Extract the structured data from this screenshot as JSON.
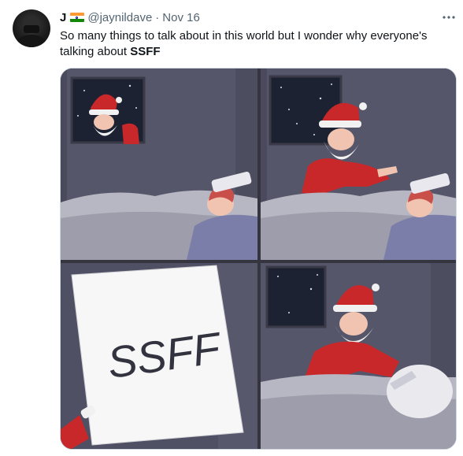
{
  "tweet": {
    "author_name": "J",
    "flag_icon": "india-flag-icon",
    "handle": "@jaynildave",
    "separator": "·",
    "date": "Nov 16",
    "more_icon": "more-options-icon",
    "text_before": "So many things to talk about in this world but I wonder why everyone's talking about ",
    "text_bold": "SSFF"
  },
  "comic": {
    "paper_text": "SSFF",
    "colors": {
      "wall": "#56566a",
      "night": "#1d2233",
      "santa_red": "#c8282a",
      "beard": "#f1f1f1",
      "blanket": "#7b7ea9",
      "bed": "#b7b7c3",
      "paper": "#f7f7f7"
    }
  }
}
